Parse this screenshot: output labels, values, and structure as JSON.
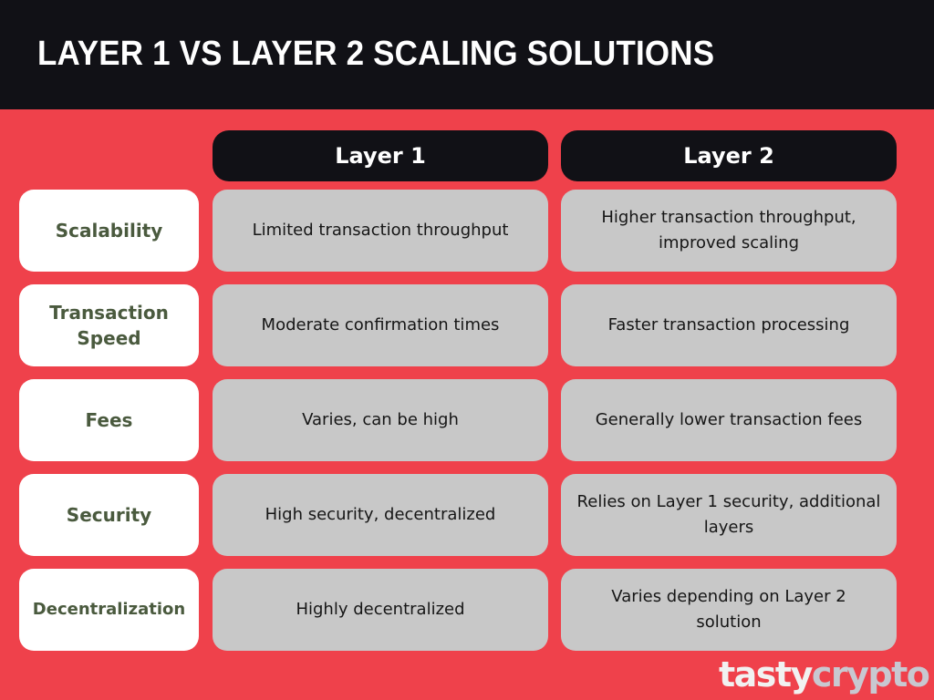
{
  "title": "LAYER 1 VS LAYER 2 SCALING SOLUTIONS",
  "columns": [
    "Layer 1",
    "Layer 2"
  ],
  "rows": [
    {
      "label": "Scalability",
      "layer1": "Limited transaction throughput",
      "layer2": "Higher transaction throughput, improved scaling"
    },
    {
      "label": "Transaction Speed",
      "layer1": "Moderate confirmation times",
      "layer2": "Faster transaction processing"
    },
    {
      "label": "Fees",
      "layer1": "Varies, can be high",
      "layer2": "Generally lower transaction fees"
    },
    {
      "label": "Security",
      "layer1": "High security, decentralized",
      "layer2": "Relies on Layer 1 security, additional layers"
    },
    {
      "label": "Decentralization",
      "layer1": "Highly decentralized",
      "layer2": "Varies depending on Layer 2 solution"
    }
  ],
  "logo": {
    "part1": "tasty",
    "part2": "crypto"
  },
  "colors": {
    "background": "#ef414b",
    "header": "#111116",
    "label_text": "#4a5a3e",
    "cell": "#c8c8c8"
  }
}
